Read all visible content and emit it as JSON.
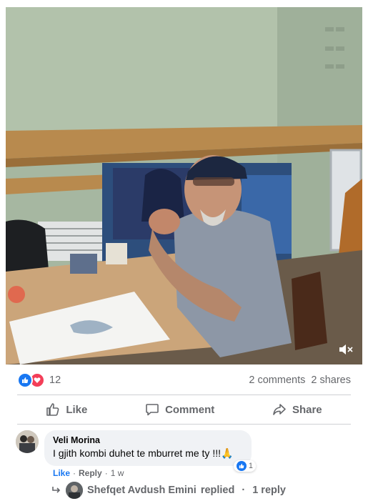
{
  "post": {
    "reactions_count": "12",
    "comments_count": "2 comments",
    "shares_count": "2 shares",
    "reaction_types": [
      "like",
      "love"
    ]
  },
  "actions": {
    "like_label": "Like",
    "comment_label": "Comment",
    "share_label": "Share"
  },
  "comment": {
    "author": "Veli Morina",
    "text": "I gjith kombi duhet te mburret me ty !!!🙏",
    "like_label": "Like",
    "reply_label": "Reply",
    "time": "1 w",
    "reaction_count": "1"
  },
  "replies": {
    "author": "Shefqet Avdush Emini",
    "replied_label": "replied",
    "separator": "·",
    "count_label": "1 reply"
  },
  "colors": {
    "accent": "#1877f2",
    "love": "#f33e58",
    "secondary_text": "#65676b",
    "bubble": "#f0f2f5"
  },
  "icons": {
    "mute": "speaker-muted-icon",
    "like": "thumbs-up-icon",
    "comment": "speech-bubble-icon",
    "share": "share-arrow-icon",
    "reply": "reply-arrow-icon"
  }
}
